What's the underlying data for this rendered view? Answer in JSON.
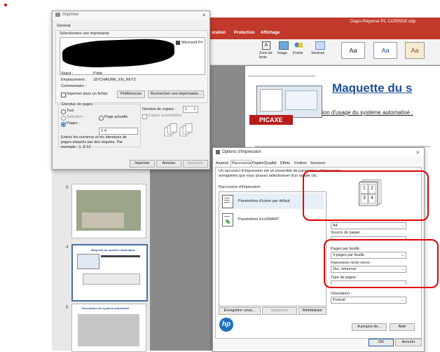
{
  "red_dot_color": "#e00000",
  "presentation": {
    "title": "Diapo-Réponse PC CORRIGE.odp",
    "menu": [
      "oration",
      "Protection",
      "Affichage"
    ],
    "ribbon": [
      "Zone de texte",
      "Image",
      "Forme",
      "Services"
    ],
    "slide_title": "Maquette du s",
    "slide_subtitle": "ion d'usage du système automatisé :",
    "logo_text": "PICAXE",
    "thumbnails": [
      {
        "num": "3",
        "title": ""
      },
      {
        "num": "4",
        "title": "Maquette du système automatisé"
      },
      {
        "num": "5",
        "title": "Description du système automatisé"
      }
    ]
  },
  "print_dialog": {
    "title": "Imprimer",
    "group_general": "Général",
    "select_printer_label": "Sélectionnez une imprimante",
    "printer_name": "Microsoft Pri",
    "status_label": "Statut :",
    "status_value": "Prête",
    "location_label": "Emplacement :",
    "location_value": "187CHAUME_EN_RETZ",
    "comment_label": "Commentaire :",
    "print_to_file": "Imprimer dans un fichier",
    "preferences": "Préférences",
    "find_printer": "Rechercher une imprimante...",
    "page_range_label": "Étendue de pages",
    "all": "Tout",
    "selection": "Sélection",
    "current_page": "Page actuelle",
    "pages": "Pages :",
    "pages_value": "1-4",
    "copies_label": "Nombre de copies :",
    "copies_value": "1",
    "collate": "Copies assemblées",
    "help_text": "Entrez les numéros et les étendues de pages séparés par des virgules. Par exemple : 1, 5-12",
    "print_button": "Imprimer",
    "cancel_button": "Annuler",
    "apply_button": "Appliquer"
  },
  "options_dialog": {
    "title": "Options d'impression",
    "tabs": [
      "Avancé",
      "Raccourcis",
      "Papier/Qualité",
      "Effets",
      "Finition",
      "Services"
    ],
    "intro": "Un raccourci d'impression est un ensemble de paramètres d'impression enregistrés que vous pouvez sélectionner d'un simple clic.",
    "shortcuts_label": "Raccourcis d'impression :",
    "shortcut_items": [
      "Paramètres d'usine par défaut",
      "Paramètres EcoSMART"
    ],
    "preview_pages": [
      "1",
      "2",
      "3",
      "4"
    ],
    "paper_size_value": "A4",
    "paper_source_label": "Source de papier :",
    "pages_per_sheet_label": "Pages par feuille :",
    "pages_per_sheet_value": "4 pages par feuille",
    "duplex_label": "Impression recto verso :",
    "duplex_value": "Oui, retourner",
    "paper_type_label": "Type de papier :",
    "orientation_label": "Orientation :",
    "orientation_value": "Portrait",
    "save_as": "Enregistrer sous...",
    "delete": "Supprimer",
    "reset": "Réinitialiser",
    "about": "A propos de...",
    "help": "Aide",
    "ok": "OK",
    "cancel": "Annuler",
    "brand": "hp"
  }
}
